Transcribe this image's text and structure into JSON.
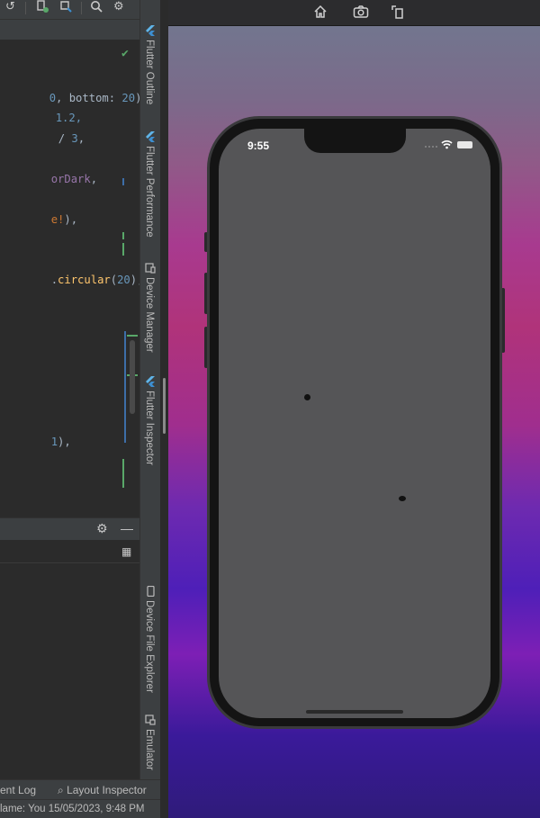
{
  "editor": {
    "lines": [
      {
        "parts": [
          {
            "t": "0",
            "c": "c-num"
          },
          {
            "t": ", bottom: ",
            "c": ""
          },
          {
            "t": "20",
            "c": "c-num"
          },
          {
            "t": "),",
            "c": ""
          }
        ]
      },
      {
        "parts": [
          {
            "t": "1.2,",
            "c": "c-num"
          }
        ]
      },
      {
        "parts": [
          {
            "t": "/ ",
            "c": ""
          },
          {
            "t": "3",
            "c": "c-num"
          },
          {
            "t": ",",
            "c": ""
          }
        ]
      },
      {
        "parts": [
          {
            "t": "orDark",
            "c": "c-id"
          },
          {
            "t": ",",
            "c": ""
          }
        ]
      },
      {
        "parts": [
          {
            "t": "e!",
            "c": "c-key"
          },
          {
            "t": "),",
            "c": ""
          }
        ]
      },
      {
        "parts": [
          {
            "t": ".",
            "c": ""
          },
          {
            "t": "circular",
            "c": "c-fn"
          },
          {
            "t": "(",
            "c": ""
          },
          {
            "t": "20",
            "c": "c-num"
          },
          {
            "t": "),  ",
            "c": ""
          },
          {
            "t": "//",
            "c": "c-cm"
          }
        ]
      },
      {
        "parts": [
          {
            "t": "1",
            "c": "c-num"
          },
          {
            "t": "),",
            "c": ""
          }
        ]
      }
    ]
  },
  "bottom_tabs": {
    "event_log": "ent Log",
    "layout_inspector": "Layout Inspector"
  },
  "status_bar": {
    "text": "lame: You 15/05/2023, 9:48 PM"
  },
  "right_tool_tabs": [
    {
      "label": "Flutter Outline",
      "icon": "flutter-icon"
    },
    {
      "label": "Flutter Performance",
      "icon": "flutter-icon"
    },
    {
      "label": "Device Manager",
      "icon": "device-icon"
    },
    {
      "label": "Flutter Inspector",
      "icon": "flutter-icon"
    },
    {
      "label": "Device File Explorer",
      "icon": "phone-icon"
    },
    {
      "label": "Emulator",
      "icon": "emulator-icon"
    }
  ],
  "simulator": {
    "toolbar": [
      "home-icon",
      "camera-icon",
      "rotate-icon"
    ],
    "phone": {
      "time": "9:55"
    }
  },
  "colors": {
    "ide_bg": "#2b2b2b",
    "ide_chrome": "#3c3f41",
    "phone_screen": "#555557",
    "check_green": "#59a869"
  }
}
